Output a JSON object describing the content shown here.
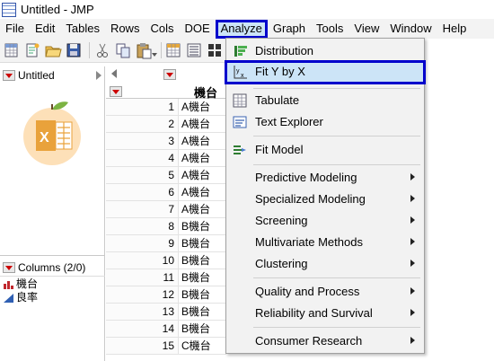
{
  "window": {
    "title": "Untitled - JMP"
  },
  "menubar": {
    "items": [
      {
        "label": "File"
      },
      {
        "label": "Edit"
      },
      {
        "label": "Tables"
      },
      {
        "label": "Rows"
      },
      {
        "label": "Cols"
      },
      {
        "label": "DOE"
      },
      {
        "label": "Analyze"
      },
      {
        "label": "Graph"
      },
      {
        "label": "Tools"
      },
      {
        "label": "View"
      },
      {
        "label": "Window"
      },
      {
        "label": "Help"
      }
    ]
  },
  "toolbar": {
    "icons": [
      "new-table-icon",
      "new-script-icon",
      "open-icon",
      "save-icon",
      "cut-icon",
      "copy-icon",
      "paste-icon",
      "data-grid-icon",
      "table-list-icon",
      "tiles-icon"
    ]
  },
  "left_panel": {
    "table_name": "Untitled",
    "columns_header": "Columns (2/0)",
    "columns": [
      {
        "name": "機台",
        "type": "nominal"
      },
      {
        "name": "良率",
        "type": "continuous"
      }
    ]
  },
  "grid": {
    "column_header": "機台",
    "rows": [
      {
        "n": "1",
        "v": "A機台"
      },
      {
        "n": "2",
        "v": "A機台"
      },
      {
        "n": "3",
        "v": "A機台"
      },
      {
        "n": "4",
        "v": "A機台"
      },
      {
        "n": "5",
        "v": "A機台"
      },
      {
        "n": "6",
        "v": "A機台"
      },
      {
        "n": "7",
        "v": "A機台"
      },
      {
        "n": "8",
        "v": "B機台"
      },
      {
        "n": "9",
        "v": "B機台"
      },
      {
        "n": "10",
        "v": "B機台"
      },
      {
        "n": "11",
        "v": "B機台"
      },
      {
        "n": "12",
        "v": "B機台"
      },
      {
        "n": "13",
        "v": "B機台"
      },
      {
        "n": "14",
        "v": "B機台"
      },
      {
        "n": "15",
        "v": "C機台"
      }
    ]
  },
  "analyze_menu": {
    "items": [
      {
        "label": "Distribution",
        "icon": "distribution-icon",
        "submenu": false
      },
      {
        "label": "Fit Y by X",
        "icon": "fit-y-by-x-icon",
        "submenu": false,
        "highlighted": true
      },
      {
        "label": "Tabulate",
        "icon": "tabulate-icon",
        "submenu": false
      },
      {
        "label": "Text Explorer",
        "icon": "text-explorer-icon",
        "submenu": false
      },
      {
        "label": "Fit Model",
        "icon": "fit-model-icon",
        "submenu": false
      },
      {
        "label": "Predictive Modeling",
        "submenu": true
      },
      {
        "label": "Specialized Modeling",
        "submenu": true
      },
      {
        "label": "Screening",
        "submenu": true
      },
      {
        "label": "Multivariate Methods",
        "submenu": true
      },
      {
        "label": "Clustering",
        "submenu": true
      },
      {
        "label": "Quality and Process",
        "submenu": true
      },
      {
        "label": "Reliability and Survival",
        "submenu": true
      },
      {
        "label": "Consumer Research",
        "submenu": true
      }
    ]
  },
  "colors": {
    "highlight_border": "#0000cc",
    "highlight_fill": "#cce4f7",
    "menu_bg": "#f2f2f2",
    "red_triangle": "#cc0000"
  }
}
